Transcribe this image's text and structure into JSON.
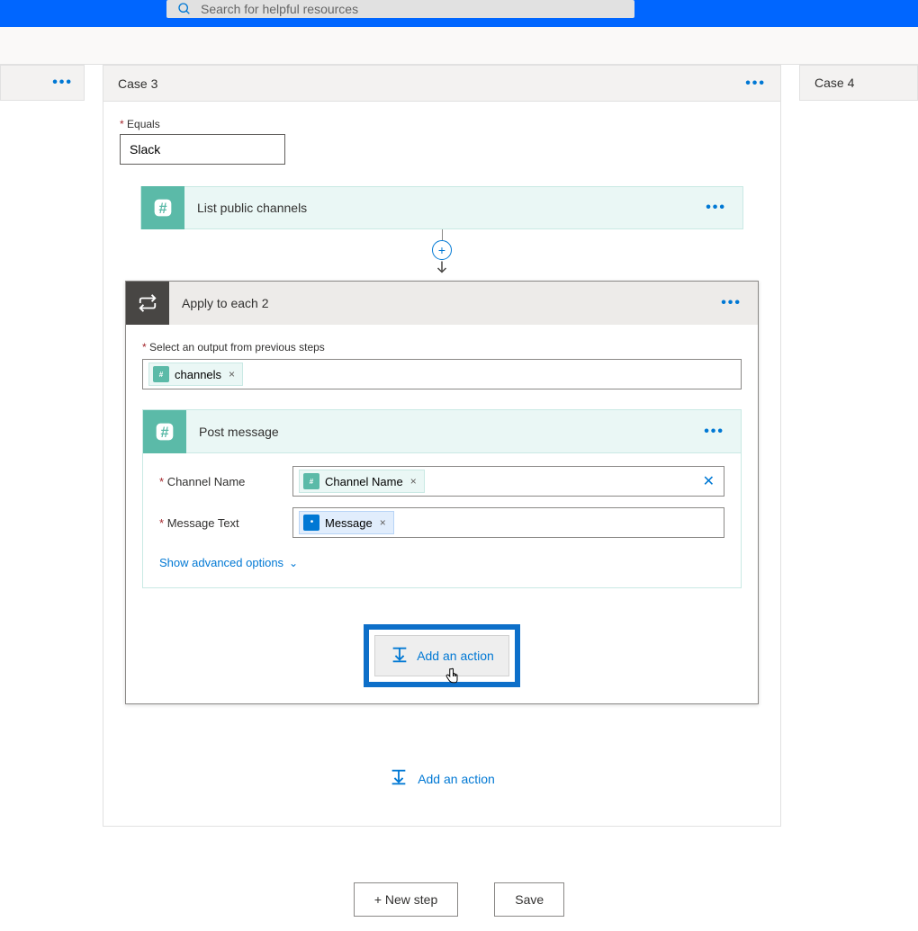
{
  "search": {
    "placeholder": "Search for helpful resources"
  },
  "cases": {
    "case3": "Case 3",
    "case4": "Case 4"
  },
  "equals": {
    "label": "Equals",
    "value": "Slack"
  },
  "slackAction": {
    "title": "List public channels"
  },
  "applyEach": {
    "title": "Apply to each 2",
    "selectLabel": "Select an output from previous steps",
    "token": "channels"
  },
  "postMessage": {
    "title": "Post message",
    "channelLabel": "Channel Name",
    "channelToken": "Channel Name",
    "messageLabel": "Message Text",
    "messageToken": "Message",
    "advanced": "Show advanced options"
  },
  "addAction": "Add an action",
  "buttons": {
    "newStep": "+ New step",
    "save": "Save"
  }
}
